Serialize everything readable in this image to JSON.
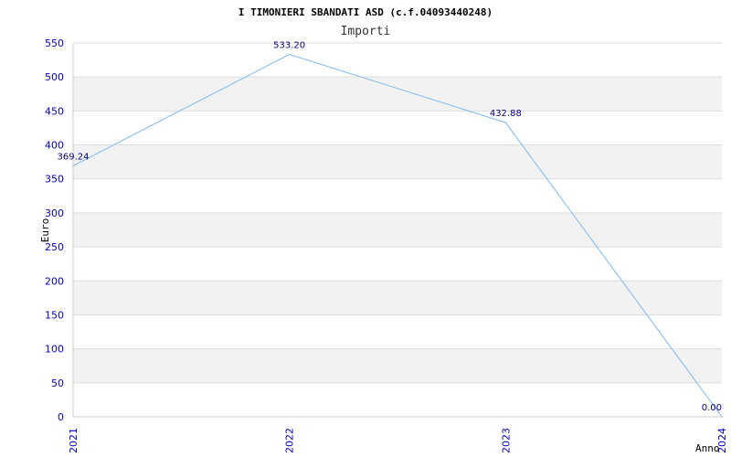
{
  "chart_data": {
    "type": "line",
    "title": "I TIMONIERI SBANDATI ASD (c.f.04093440248)",
    "subtitle": "Importi",
    "xlabel": "Anno",
    "ylabel": "Euro",
    "categories": [
      "2021",
      "2022",
      "2023",
      "2024"
    ],
    "series": [
      {
        "values": [
          369.24,
          533.2,
          432.88,
          0.0
        ],
        "labels": [
          "369.24",
          "533.20",
          "432.88",
          "0.00"
        ]
      }
    ],
    "ylim": [
      0,
      550
    ],
    "yticks": [
      0,
      50,
      100,
      150,
      200,
      250,
      300,
      350,
      400,
      450,
      500,
      550
    ],
    "grid": true,
    "colors": {
      "line": "#7fb8f0",
      "band": "#f2f2f2",
      "gridline": "#dddddd",
      "tick_text": "#0000cc",
      "data_label": "#000080"
    }
  }
}
